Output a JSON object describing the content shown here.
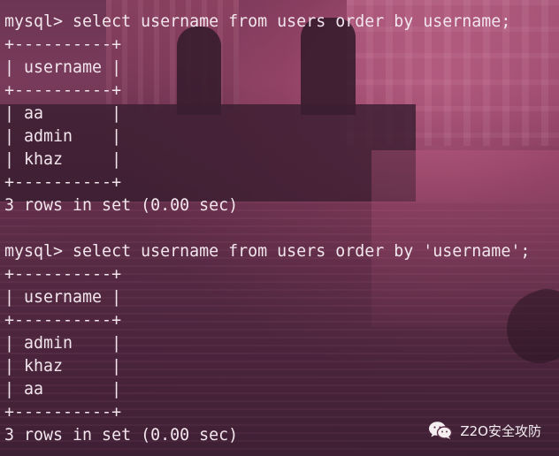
{
  "terminal": {
    "lines": [
      "mysql> select username from users order by username;",
      "+----------+",
      "| username |",
      "+----------+",
      "| aa       |",
      "| admin    |",
      "| khaz     |",
      "+----------+",
      "3 rows in set (0.00 sec)",
      "",
      "mysql> select username from users order by 'username';",
      "+----------+",
      "| username |",
      "+----------+",
      "| admin    |",
      "| khaz     |",
      "| aa       |",
      "+----------+",
      "3 rows in set (0.00 sec)"
    ]
  },
  "watermark": {
    "icon": "wechat-icon",
    "text": "Z2O安全攻防"
  },
  "colors": {
    "text": "#f2e6ec",
    "background": "#5a2f47"
  }
}
